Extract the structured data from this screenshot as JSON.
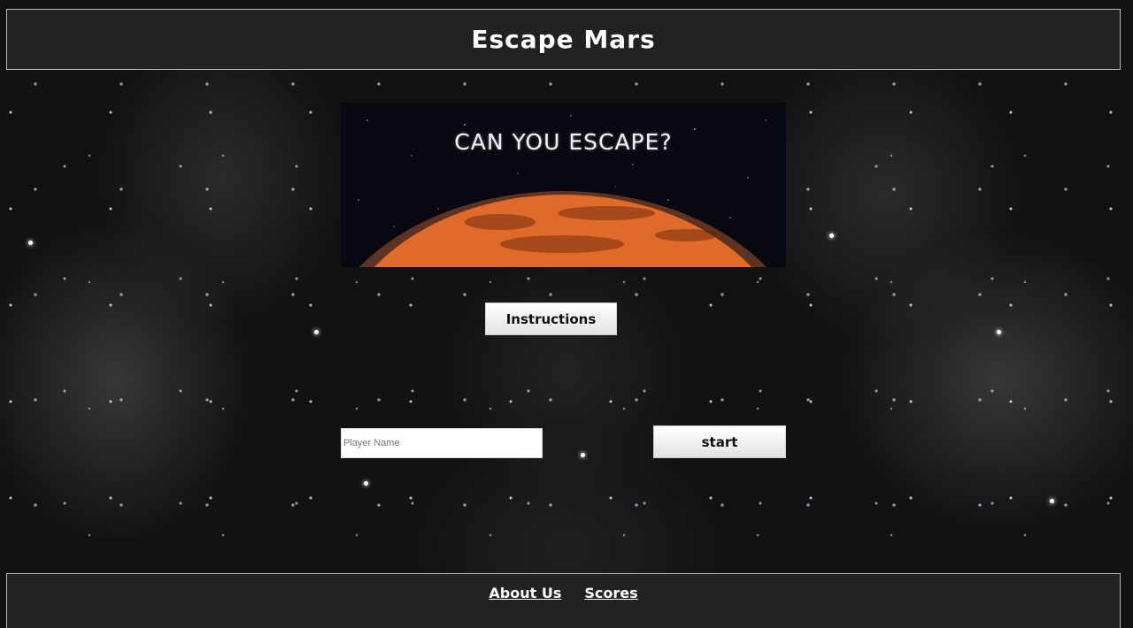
{
  "header": {
    "title": "Escape Mars"
  },
  "banner": {
    "text": "CAN YOU ESCAPE?"
  },
  "buttons": {
    "instructions_label": "Instructions",
    "start_label": "start"
  },
  "player_input": {
    "placeholder": "Player Name",
    "value": ""
  },
  "footer": {
    "links": [
      "About Us",
      "Scores"
    ]
  },
  "colors": {
    "bar_background": "#232222",
    "bar_border": "#b8b8b8",
    "mars": "#b8431c"
  },
  "icons": {
    "banner_image": "mars-planet-horizon"
  }
}
